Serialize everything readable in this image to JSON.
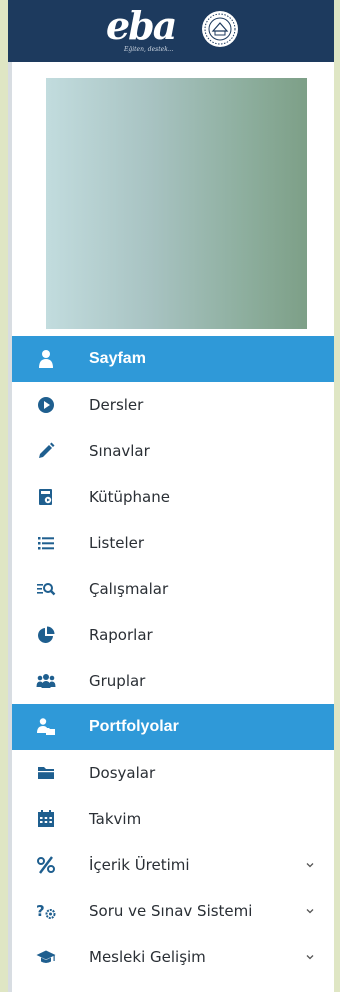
{
  "header": {
    "logo_text": "eba",
    "logo_slogan": "Eğiten, destek..."
  },
  "colors": {
    "header_bg": "#1d3a5e",
    "active_bg": "#2f99d8",
    "icon_color": "#1f5f8f",
    "page_bg": "#dfe6c4"
  },
  "menu": [
    {
      "label": "Sayfam",
      "icon": "user-icon",
      "active": true
    },
    {
      "label": "Dersler",
      "icon": "play-circle-icon"
    },
    {
      "label": "Sınavlar",
      "icon": "pencil-icon"
    },
    {
      "label": "Kütüphane",
      "icon": "library-icon"
    },
    {
      "label": "Listeler",
      "icon": "list-icon"
    },
    {
      "label": "Çalışmalar",
      "icon": "search-list-icon"
    },
    {
      "label": "Raporlar",
      "icon": "pie-chart-icon"
    },
    {
      "label": "Gruplar",
      "icon": "users-icon"
    },
    {
      "label": "Portfolyolar",
      "icon": "user-folder-icon",
      "active": true
    },
    {
      "label": "Dosyalar",
      "icon": "folder-icon"
    },
    {
      "label": "Takvim",
      "icon": "calendar-icon"
    },
    {
      "label": "İçerik Üretimi",
      "icon": "percent-icon",
      "expandable": true
    },
    {
      "label": "Soru ve Sınav Sistemi",
      "icon": "question-gear-icon",
      "expandable": true
    },
    {
      "label": "Mesleki Gelişim",
      "icon": "graduation-cap-icon",
      "expandable": true
    }
  ]
}
